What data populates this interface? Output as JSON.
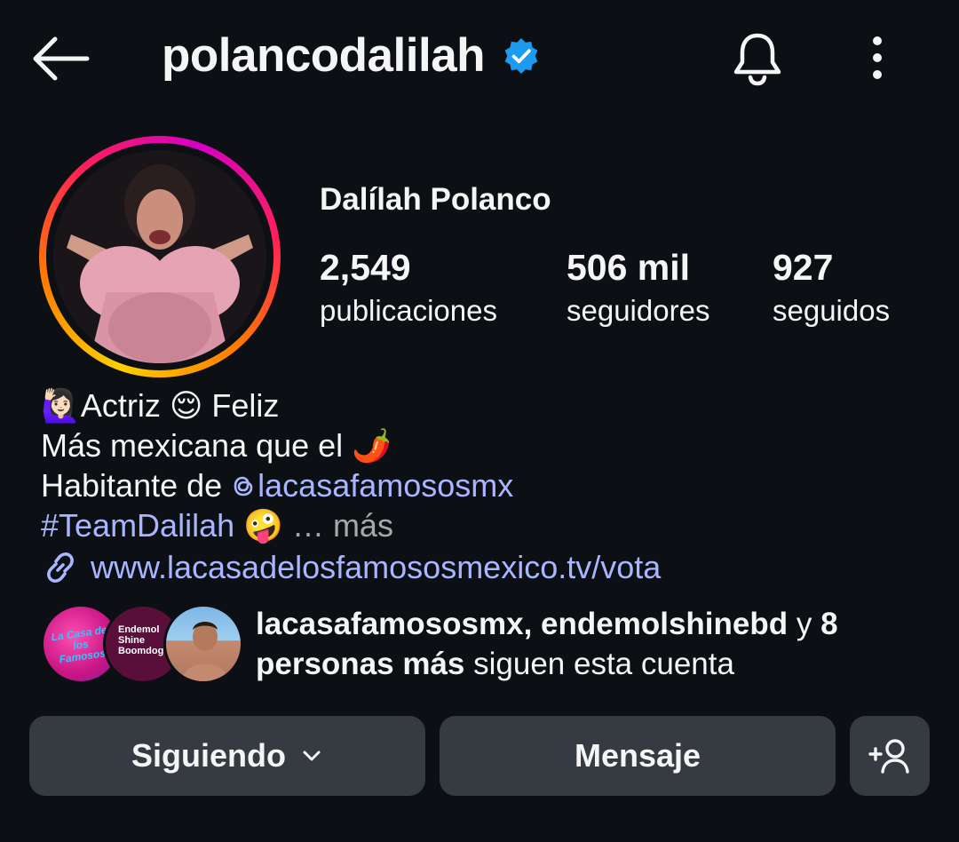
{
  "header": {
    "username": "polancodalilah",
    "back_icon": "arrow-left-icon",
    "verified_icon": "verified-badge-icon",
    "bell_icon": "bell-icon",
    "more_icon": "more-vertical-icon",
    "verified_color": "#1d9bf0"
  },
  "profile": {
    "full_name": "Dalílah Polanco",
    "stats": [
      {
        "value": "2,549",
        "label": "publicaciones"
      },
      {
        "value": "506 mil",
        "label": "seguidores"
      },
      {
        "value": "927",
        "label": "seguidos"
      }
    ]
  },
  "bio": {
    "line1_emoji1": "🙋🏻‍♀️",
    "line1_text1": "Actriz ",
    "line1_emoji2": "😌",
    "line1_text2": " Feliz",
    "line2_text": "Más mexicana que el ",
    "line2_emoji": "🌶️",
    "line3_text": "Habitante de ",
    "line3_mention": "lacasafamososmx",
    "line4_hashtag": "#TeamDalilah",
    "line4_emoji": "🤪",
    "line4_more": " … más",
    "link": "www.lacasadelosfamososmexico.tv/vota"
  },
  "followed_by": {
    "account1": "lacasafamososmx",
    "separator": ", ",
    "account2": "endemolshinebd",
    "connector": " y ",
    "others": "8 personas más",
    "suffix": " siguen esta cuenta",
    "avatar1_text": "La Casa de los Famosos",
    "avatar2_line1": "Endemol",
    "avatar2_line2": "Shine",
    "avatar2_line3": "Boomdog"
  },
  "actions": {
    "following_label": "Siguiendo",
    "message_label": "Mensaje",
    "add_person_icon": "add-person-icon",
    "button_color": "#363a41"
  },
  "colors": {
    "background": "#0c1014",
    "link": "#a9b6ff"
  }
}
